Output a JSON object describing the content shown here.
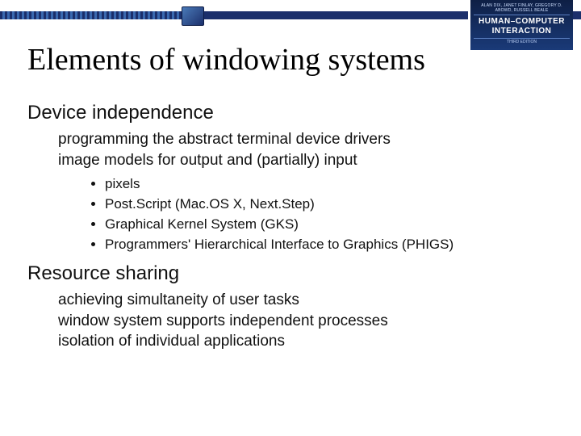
{
  "book": {
    "authors": "ALAN DIX, JANET FINLAY, GREGORY D. ABOWD, RUSSELL BEALE",
    "title": "HUMAN–COMPUTER INTERACTION",
    "edition": "THIRD EDITION"
  },
  "slide": {
    "title": "Elements of windowing systems",
    "sections": [
      {
        "head": "Device independence",
        "subs": [
          "programming the abstract terminal device drivers",
          "image models for output and (partially) input"
        ],
        "bullets": [
          "pixels",
          "Post.Script  (Mac.OS X, Next.Step)",
          "Graphical Kernel System (GKS)",
          "Programmers' Hierarchical Interface to Graphics (PHIGS)"
        ]
      },
      {
        "head": "Resource sharing",
        "subs": [
          "achieving simultaneity of user tasks",
          "window system supports independent processes",
          "isolation of individual applications"
        ],
        "bullets": []
      }
    ]
  }
}
